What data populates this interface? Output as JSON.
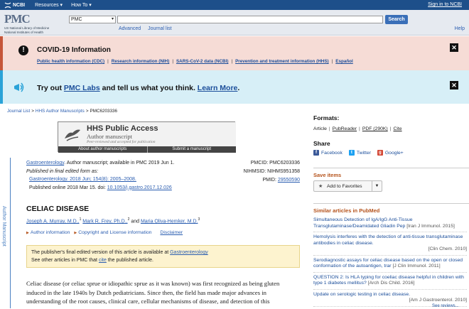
{
  "ncbi_bar": {
    "logo": "NCBI",
    "menus": [
      "Resources",
      "How To"
    ],
    "signin": "Sign in to NCBI"
  },
  "header": {
    "logo_text": "PMC",
    "logo_sub1": "US National Library of Medicine",
    "logo_sub2": "National Institutes of Health",
    "db_selected": "PMC",
    "search_value": "",
    "search_button": "Search",
    "advanced": "Advanced",
    "journal_list": "Journal list",
    "help": "Help"
  },
  "covid": {
    "title": "COVID-19 Information",
    "links": [
      "Public health information (CDC)",
      "Research information (NIH)",
      "SARS-CoV-2 data (NCBI)",
      "Prevention and treatment information (HHS)",
      "Español"
    ],
    "separator": "|"
  },
  "labs": {
    "pre": "Try out ",
    "link": "PMC Labs",
    "mid": " and tell us what you think. ",
    "learn": "Learn More",
    "post": "."
  },
  "breadcrumb": {
    "items": [
      "Journal List",
      "HHS Author Manuscripts"
    ],
    "current": "PMC6203336",
    "sep": ">"
  },
  "hhs": {
    "title": "HHS Public Access",
    "subtitle": "Author manuscript",
    "tagline": "Peer-reviewed and accepted for publication",
    "about": "About author manuscripts",
    "submit": "Submit a manuscript"
  },
  "side_label": "Author Manuscript",
  "citation": {
    "journal": "Gastroenterology",
    "line1_rest": ". Author manuscript; available in PMC 2019 Jun 1.",
    "line2": "Published in final edited form as:",
    "line3": "Gastroenterology. 2018 Jun; 154(8): 2005–2008.",
    "line4_pre": "Published online 2018 Mar 15. doi: ",
    "doi": "10.1053/j.gastro.2017.12.026"
  },
  "ids": {
    "pmcid": "PMCID: PMC6203336",
    "nihmsid": "NIHMSID: NIHMS951358",
    "pmid_label": "PMID: ",
    "pmid": "29550590"
  },
  "article": {
    "title": "CELIAC DISEASE",
    "authors": [
      {
        "name": "Joseph A. Murray, M.D.,",
        "sup": "1"
      },
      {
        "name": "Mark R. Frey, Ph.D.,",
        "sup": "2"
      },
      {
        "name": "Maria Oliva-Hemker, M.D.",
        "sup": "3"
      }
    ],
    "and": "and",
    "author_info": "Author information",
    "copyright": "Copyright and License information",
    "disclaimer": "Disclaimer"
  },
  "notice": {
    "line1_pre": "The publisher's final edited version of this article is available at ",
    "line1_link": "Gastroenterology",
    "line2_pre": "See other articles in PMC that ",
    "line2_link": "cite",
    "line2_post": " the published article."
  },
  "body_text": "Celiac disease (or celiac sprue or idiopathic sprue as it was known) was first recognized as being gluten induced in the late 1940s by Dutch pediatricians. Since then, the field has made major advances in understanding of the root causes, clinical care, cellular mechanisms of disease, and detection of this",
  "formats": {
    "heading": "Formats:",
    "items": [
      "Article",
      "PubReader",
      "PDF (290K)",
      "Cite"
    ]
  },
  "share": {
    "heading": "Share",
    "items": [
      "Facebook",
      "Twitter",
      "Google+"
    ]
  },
  "save": {
    "heading": "Save items",
    "button": "Add to Favorites"
  },
  "similar": {
    "heading": "Similar articles in PubMed",
    "items": [
      {
        "title": "Simultaneous Detection of IgA/IgG Anti-Tissue Transglutaminase/Deamidated Gliadin Pep",
        "src": "[Iran J Immunol. 2015]"
      },
      {
        "title": "Hemolysis interferes with the detection of anti-tissue transglutaminase antibodies in celiac disease.",
        "src": "[Clin Chem. 2010]"
      },
      {
        "title": "Serodiagnostic assays for celiac disease based on the open or closed conformation of the autoantigen, trar",
        "src": "[J Clin Immunol. 2011]"
      },
      {
        "title": "QUESTION 2: Is HLA typing for coeliac disease helpful in children with type 1 diabetes mellitus?",
        "src": "[Arch Dis Child. 2016]"
      },
      {
        "title": "Update on serologic testing in celiac disease.",
        "src": "[Am J Gastroenterol. 2010]"
      }
    ],
    "see_reviews": "See reviews..."
  }
}
